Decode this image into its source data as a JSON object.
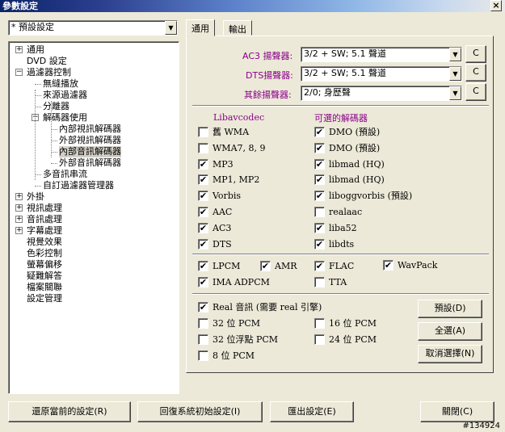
{
  "window": {
    "title": "參數設定",
    "close_label": "×"
  },
  "preset": {
    "value": "* 預設設定"
  },
  "tree": [
    {
      "label": "通用",
      "level": 0,
      "expander": "+"
    },
    {
      "label": "DVD 設定",
      "level": 0,
      "expander": ""
    },
    {
      "label": "過濾器控制",
      "level": 0,
      "expander": "−"
    },
    {
      "label": "無縫播放",
      "level": 1,
      "expander": ""
    },
    {
      "label": "來源過濾器",
      "level": 1,
      "expander": ""
    },
    {
      "label": "分離器",
      "level": 1,
      "expander": ""
    },
    {
      "label": "解碼器使用",
      "level": 1,
      "expander": "−"
    },
    {
      "label": "內部視訊解碼器",
      "level": 2,
      "expander": ""
    },
    {
      "label": "外部視訊解碼器",
      "level": 2,
      "expander": ""
    },
    {
      "label": "內部音訊解碼器",
      "level": 2,
      "expander": "",
      "selected": true
    },
    {
      "label": "外部音訊解碼器",
      "level": 2,
      "expander": ""
    },
    {
      "label": "多音訊串流",
      "level": 1,
      "expander": ""
    },
    {
      "label": "自訂過濾器管理器",
      "level": 1,
      "expander": ""
    },
    {
      "label": "外掛",
      "level": 0,
      "expander": "+"
    },
    {
      "label": "視訊處理",
      "level": 0,
      "expander": "+"
    },
    {
      "label": "音訊處理",
      "level": 0,
      "expander": "+"
    },
    {
      "label": "字幕處理",
      "level": 0,
      "expander": "+"
    },
    {
      "label": "視覺效果",
      "level": 0,
      "expander": ""
    },
    {
      "label": "色彩控制",
      "level": 0,
      "expander": ""
    },
    {
      "label": "螢幕偏移",
      "level": 0,
      "expander": ""
    },
    {
      "label": "疑難解答",
      "level": 0,
      "expander": ""
    },
    {
      "label": "檔案關聯",
      "level": 0,
      "expander": ""
    },
    {
      "label": "設定管理",
      "level": 0,
      "expander": ""
    }
  ],
  "tabs": {
    "general": "通用",
    "output": "輸出"
  },
  "speakers": {
    "ac3": {
      "label_pre": "AC3 揚聲器",
      "hotkey": "",
      "value": "3/2 + SW; 5.1 聲道",
      "c": "C"
    },
    "dts": {
      "label_pre": "DTS揚聲器",
      "value": "3/2 + SW; 5.1 聲道",
      "c": "C"
    },
    "other": {
      "label_pre": "其餘揚聲器",
      "value": "2/0; 身歷聲",
      "c": "C"
    }
  },
  "decoders": {
    "col1_header": "Libavcodec",
    "col2_header": "可選的解碼器",
    "col1": [
      {
        "label": "舊 WMA",
        "checked": false
      },
      {
        "label": "WMA7, 8, 9",
        "checked": false
      },
      {
        "label": "MP3",
        "checked": true
      },
      {
        "label": "MP1, MP2",
        "checked": true
      },
      {
        "label": "Vorbis",
        "checked": true
      },
      {
        "label": "AAC",
        "checked": true
      },
      {
        "label": "AC3",
        "checked": true
      },
      {
        "label": "DTS",
        "checked": true
      }
    ],
    "col2": [
      {
        "label": "DMO (預設)",
        "checked": true
      },
      {
        "label": "DMO (預設)",
        "checked": true
      },
      {
        "label": "libmad (HQ)",
        "checked": true
      },
      {
        "label": "libmad (HQ)",
        "checked": true
      },
      {
        "label": "liboggvorbis (預設)",
        "checked": true
      },
      {
        "label": "realaac",
        "checked": false
      },
      {
        "label": "liba52",
        "checked": true
      },
      {
        "label": "libdts",
        "checked": true
      }
    ]
  },
  "extra_formats": [
    {
      "label": "LPCM",
      "checked": true
    },
    {
      "label": "AMR",
      "checked": true
    },
    {
      "label": "FLAC",
      "checked": true
    },
    {
      "label": "WavPack",
      "checked": true
    },
    {
      "label": "IMA ADPCM",
      "checked": true
    },
    {
      "label": "TTA",
      "checked": false
    }
  ],
  "output_formats": [
    {
      "label": "Real 音訊 (需要 real 引擎)",
      "checked": true
    },
    {
      "label": "32 位 PCM",
      "checked": false
    },
    {
      "label": "16 位 PCM",
      "checked": false
    },
    {
      "label": "32 位浮點 PCM",
      "checked": false
    },
    {
      "label": "24 位 PCM",
      "checked": false
    },
    {
      "label": "8 位 PCM",
      "checked": false
    }
  ],
  "side_buttons": {
    "default": "預設(D)",
    "select_all": "全選(A)",
    "deselect": "取消選擇(N)"
  },
  "bottom_buttons": {
    "restore": "還原當前的設定(R)",
    "reset": "回復系統初始設定(I)",
    "export": "匯出設定(E)",
    "close": "關閉(C)"
  },
  "watermark": "#134924"
}
